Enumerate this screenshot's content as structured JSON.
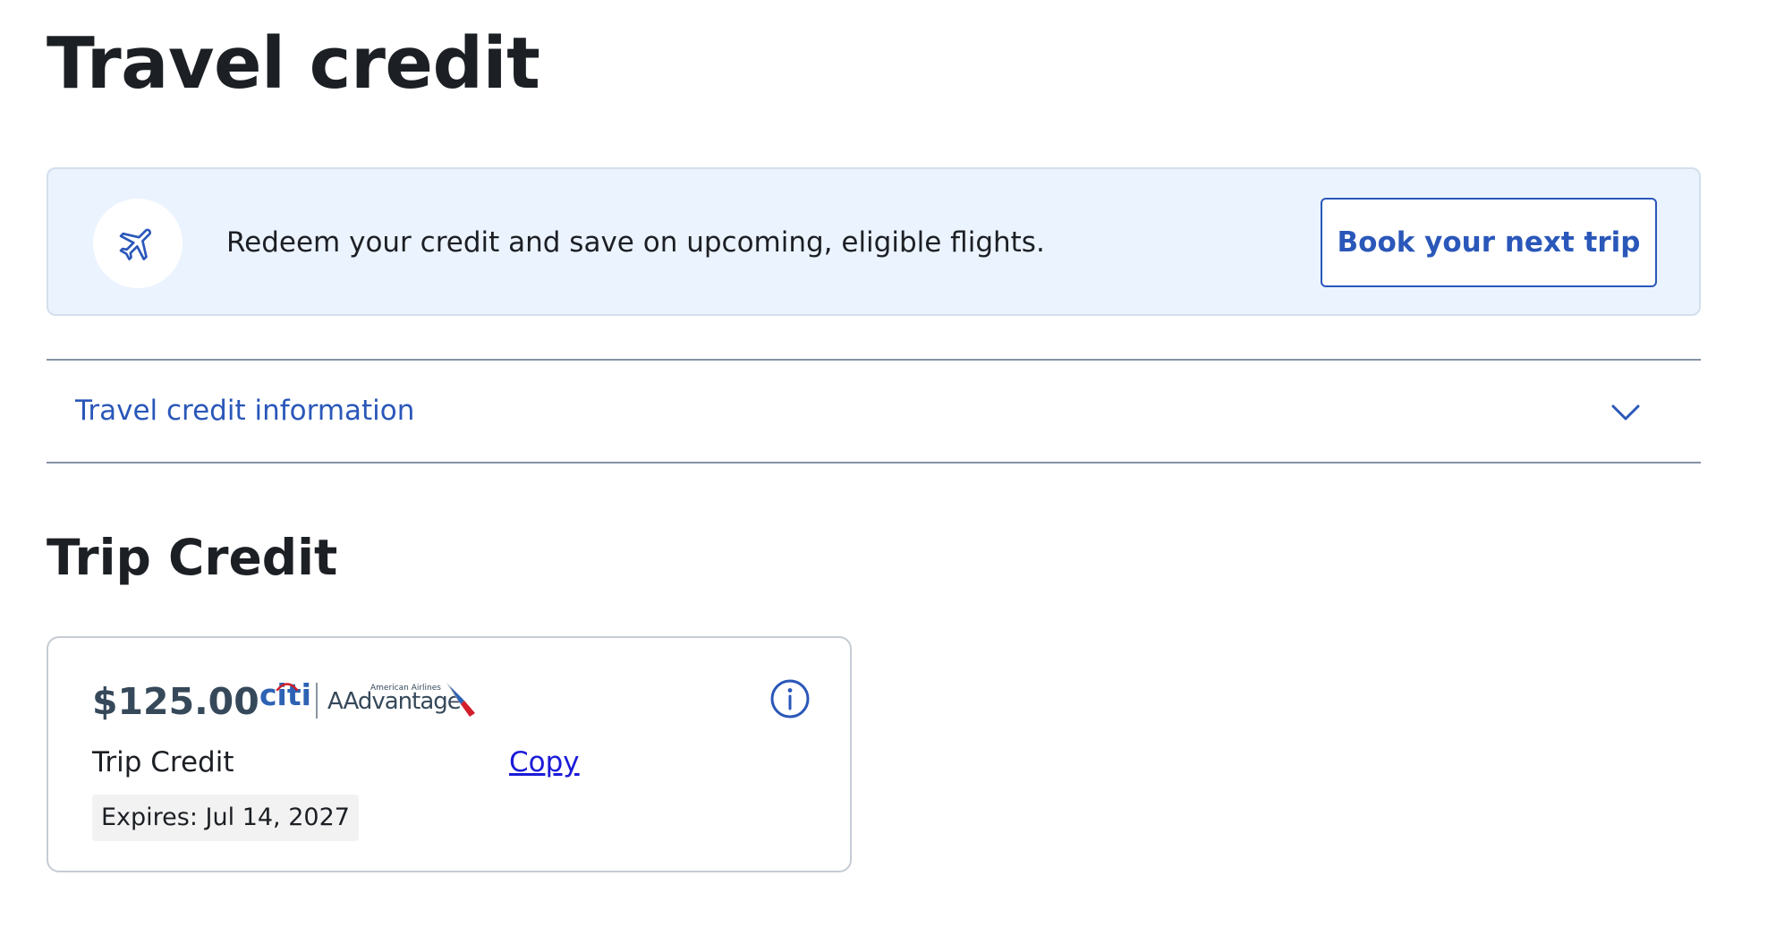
{
  "page": {
    "title": "Travel credit"
  },
  "promo": {
    "icon": "airplane-icon",
    "text": "Redeem your credit and save on upcoming, eligible flights.",
    "button_label": "Book your next trip"
  },
  "accordion": {
    "label": "Travel credit information",
    "icon": "chevron-down-icon",
    "expanded": false
  },
  "section": {
    "title": "Trip Credit"
  },
  "credit": {
    "amount": "$125.00",
    "logo": {
      "citi": "citi",
      "aa_small": "American Airlines",
      "aa_word": "AAdvantage"
    },
    "info_icon": "info-icon",
    "type": "Trip Credit",
    "copy_label": "Copy",
    "expires": "Expires: Jul 14, 2027"
  },
  "colors": {
    "text": "#1c1f24",
    "accent_blue": "#2a57b9",
    "banner_bg": "#ebf3fe",
    "link": "#1a1bd8",
    "aa_red": "#d21e2b",
    "aa_blue": "#2d62b4"
  }
}
